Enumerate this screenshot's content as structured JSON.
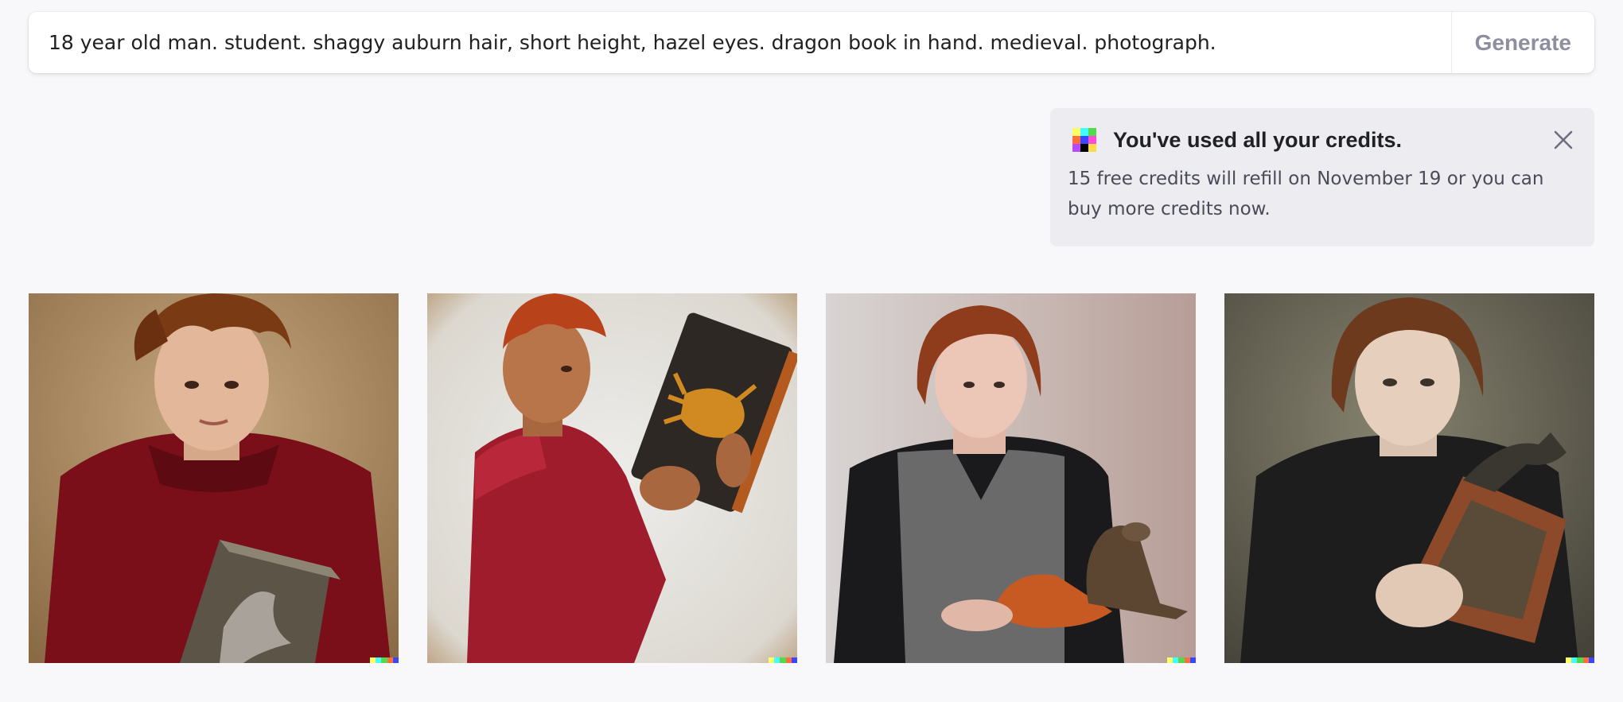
{
  "prompt": {
    "value": "18 year old man. student. shaggy auburn hair, short height, hazel eyes. dragon book in hand. medieval. photograph.",
    "generate_label": "Generate"
  },
  "toast": {
    "logo_icon": "dall-e-logo-icon",
    "title": "You've used all your credits.",
    "message": "15 free credits will refill on November 19 or you can buy more credits now.",
    "close_icon": "close-icon",
    "logo_colors": [
      "#ffff66",
      "#42ffff",
      "#51da4c",
      "#ff6e3c",
      "#3c46ff",
      "#ff4bd6",
      "#b44bff",
      "#000000",
      "#ffdb4b"
    ]
  },
  "results": [
    {
      "icon": "generated-image-1"
    },
    {
      "icon": "generated-image-2"
    },
    {
      "icon": "generated-image-3"
    },
    {
      "icon": "generated-image-4"
    }
  ],
  "colors": {
    "background": "#f8f8fa",
    "toast_bg": "#ececf1",
    "signature": [
      "#ffff66",
      "#42ffff",
      "#51da4c",
      "#ff6e3c",
      "#3c46ff"
    ]
  }
}
